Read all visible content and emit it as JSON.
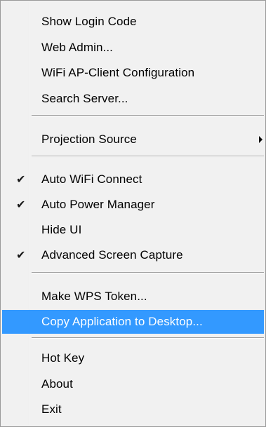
{
  "menu": {
    "items": [
      {
        "label": "Show Login Code"
      },
      {
        "label": "Web Admin..."
      },
      {
        "label": "WiFi AP-Client Configuration"
      },
      {
        "label": "Search Server..."
      },
      {
        "label": "Projection Source",
        "submenu_icon": "chevron-right-icon"
      },
      {
        "label": "Auto WiFi Connect",
        "checked": true,
        "check_icon": "✔"
      },
      {
        "label": "Auto Power Manager",
        "checked": true,
        "check_icon": "✔"
      },
      {
        "label": "Hide UI"
      },
      {
        "label": "Advanced Screen Capture",
        "checked": true,
        "check_icon": "✔"
      },
      {
        "label": "Make WPS Token..."
      },
      {
        "label": "Copy Application to Desktop...",
        "highlighted": true
      },
      {
        "label": "Hot Key"
      },
      {
        "label": "About"
      },
      {
        "label": "Exit"
      }
    ]
  },
  "colors": {
    "background": "#f1f1f1",
    "highlight": "#3399ff",
    "highlight_text": "#ffffff",
    "text": "#000000",
    "separator": "#a0a0a0"
  }
}
